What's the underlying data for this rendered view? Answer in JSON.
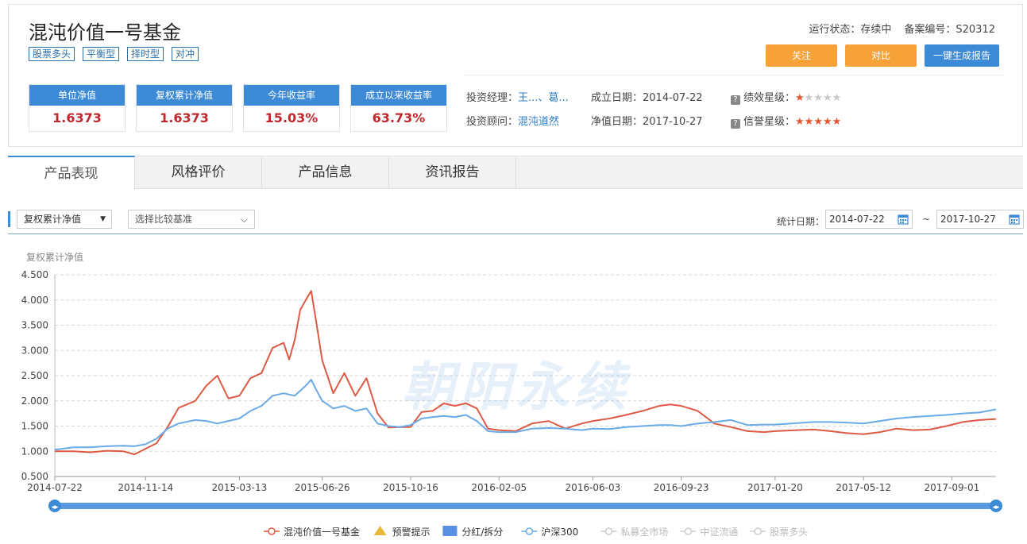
{
  "fund": {
    "title": "混沌价值一号基金",
    "tags": [
      "股票多头",
      "平衡型",
      "择时型",
      "对冲"
    ],
    "status_label": "运行状态：",
    "status_value": "存续中",
    "record_label": "备案编号：",
    "record_value": "S20312",
    "buttons": {
      "follow": "关注",
      "compare": "对比",
      "report": "一键生成报告"
    }
  },
  "stats": [
    {
      "label": "单位净值",
      "value": "1.6373"
    },
    {
      "label": "复权累计净值",
      "value": "1.6373"
    },
    {
      "label": "今年收益率",
      "value": "15.03%"
    },
    {
      "label": "成立以来收益率",
      "value": "63.73%"
    }
  ],
  "info": {
    "manager_label": "投资经理：",
    "manager_value": "王...、葛...",
    "advisor_label": "投资顾问：",
    "advisor_value": "混沌道然",
    "found_label": "成立日期：",
    "found_value": "2014-07-22",
    "nav_date_label": "净值日期：",
    "nav_date_value": "2017-10-27",
    "perf_label": "绩效星级：",
    "perf_stars": 1,
    "credit_label": "信誉星级：",
    "credit_stars": 5,
    "q_icon": "?"
  },
  "tabs": [
    "产品表现",
    "风格评价",
    "产品信息",
    "资讯报告"
  ],
  "toolbar": {
    "metric_select": "复权累计净值",
    "compare_select": "选择比较基准",
    "date_label": "统计日期：",
    "start_date": "2014-07-22",
    "end_date": "2017-10-27",
    "tilde": "~"
  },
  "colors": {
    "accent": "#3d8ad7",
    "fund_line": "#dd5a44",
    "index_line": "#6aaae6",
    "value_red": "#c0282d",
    "button_orange": "#f6a239"
  },
  "watermark": "朝阳永续",
  "chart_data": {
    "type": "line",
    "ylabel": "复权累计净值",
    "ylim": [
      0.5,
      4.5
    ],
    "yticks": [
      "4.500",
      "4.000",
      "3.500",
      "3.000",
      "2.500",
      "2.000",
      "1.500",
      "1.000",
      "0.500"
    ],
    "xticks": [
      "2014-07-22",
      "2014-11-14",
      "2015-03-13",
      "2015-06-26",
      "2015-10-16",
      "2016-02-05",
      "2016-06-03",
      "2016-09-23",
      "2017-01-20",
      "2017-05-12",
      "2017-09-01"
    ],
    "x_range": [
      "2014-07-22",
      "2017-10-27"
    ],
    "grid": true,
    "legend_position": "bottom",
    "series": [
      {
        "name": "混沌价值一号基金",
        "color": "#dd5a44",
        "points": [
          [
            "2014-07-22",
            1.0
          ],
          [
            "2014-08-15",
            1.0
          ],
          [
            "2014-09-05",
            0.98
          ],
          [
            "2014-09-26",
            1.01
          ],
          [
            "2014-10-17",
            1.0
          ],
          [
            "2014-10-31",
            0.94
          ],
          [
            "2014-11-14",
            1.05
          ],
          [
            "2014-11-28",
            1.16
          ],
          [
            "2014-12-12",
            1.48
          ],
          [
            "2014-12-26",
            1.86
          ],
          [
            "2015-01-16",
            2.0
          ],
          [
            "2015-01-30",
            2.3
          ],
          [
            "2015-02-13",
            2.5
          ],
          [
            "2015-02-27",
            2.05
          ],
          [
            "2015-03-13",
            2.1
          ],
          [
            "2015-03-27",
            2.45
          ],
          [
            "2015-04-10",
            2.55
          ],
          [
            "2015-04-24",
            3.05
          ],
          [
            "2015-05-08",
            3.15
          ],
          [
            "2015-05-15",
            2.82
          ],
          [
            "2015-05-22",
            3.2
          ],
          [
            "2015-05-29",
            3.8
          ],
          [
            "2015-06-05",
            4.0
          ],
          [
            "2015-06-12",
            4.18
          ],
          [
            "2015-06-19",
            3.5
          ],
          [
            "2015-06-26",
            2.8
          ],
          [
            "2015-07-10",
            2.15
          ],
          [
            "2015-07-24",
            2.55
          ],
          [
            "2015-08-07",
            2.1
          ],
          [
            "2015-08-21",
            2.45
          ],
          [
            "2015-09-04",
            1.75
          ],
          [
            "2015-09-18",
            1.47
          ],
          [
            "2015-10-02",
            1.48
          ],
          [
            "2015-10-16",
            1.48
          ],
          [
            "2015-10-30",
            1.78
          ],
          [
            "2015-11-13",
            1.8
          ],
          [
            "2015-11-27",
            1.95
          ],
          [
            "2015-12-11",
            1.9
          ],
          [
            "2015-12-25",
            1.95
          ],
          [
            "2016-01-08",
            1.85
          ],
          [
            "2016-01-22",
            1.45
          ],
          [
            "2016-02-05",
            1.42
          ],
          [
            "2016-02-26",
            1.4
          ],
          [
            "2016-03-18",
            1.55
          ],
          [
            "2016-04-08",
            1.6
          ],
          [
            "2016-04-29",
            1.45
          ],
          [
            "2016-05-20",
            1.55
          ],
          [
            "2016-06-03",
            1.6
          ],
          [
            "2016-06-24",
            1.65
          ],
          [
            "2016-07-15",
            1.72
          ],
          [
            "2016-08-05",
            1.8
          ],
          [
            "2016-08-26",
            1.9
          ],
          [
            "2016-09-09",
            1.93
          ],
          [
            "2016-09-23",
            1.9
          ],
          [
            "2016-10-14",
            1.8
          ],
          [
            "2016-11-04",
            1.55
          ],
          [
            "2016-11-25",
            1.48
          ],
          [
            "2016-12-16",
            1.4
          ],
          [
            "2017-01-06",
            1.38
          ],
          [
            "2017-01-20",
            1.4
          ],
          [
            "2017-02-17",
            1.42
          ],
          [
            "2017-03-10",
            1.43
          ],
          [
            "2017-03-31",
            1.4
          ],
          [
            "2017-04-21",
            1.36
          ],
          [
            "2017-05-12",
            1.34
          ],
          [
            "2017-06-02",
            1.38
          ],
          [
            "2017-06-23",
            1.45
          ],
          [
            "2017-07-14",
            1.42
          ],
          [
            "2017-08-04",
            1.43
          ],
          [
            "2017-08-25",
            1.5
          ],
          [
            "2017-09-15",
            1.58
          ],
          [
            "2017-10-06",
            1.62
          ],
          [
            "2017-10-27",
            1.64
          ]
        ]
      },
      {
        "name": "沪深300",
        "color": "#6aaae6",
        "points": [
          [
            "2014-07-22",
            1.03
          ],
          [
            "2014-08-15",
            1.08
          ],
          [
            "2014-09-05",
            1.08
          ],
          [
            "2014-09-26",
            1.1
          ],
          [
            "2014-10-17",
            1.11
          ],
          [
            "2014-10-31",
            1.1
          ],
          [
            "2014-11-14",
            1.14
          ],
          [
            "2014-11-28",
            1.25
          ],
          [
            "2014-12-12",
            1.45
          ],
          [
            "2014-12-26",
            1.55
          ],
          [
            "2015-01-16",
            1.62
          ],
          [
            "2015-01-30",
            1.6
          ],
          [
            "2015-02-13",
            1.55
          ],
          [
            "2015-02-27",
            1.6
          ],
          [
            "2015-03-13",
            1.65
          ],
          [
            "2015-03-27",
            1.8
          ],
          [
            "2015-04-10",
            1.9
          ],
          [
            "2015-04-24",
            2.1
          ],
          [
            "2015-05-08",
            2.15
          ],
          [
            "2015-05-22",
            2.1
          ],
          [
            "2015-06-05",
            2.3
          ],
          [
            "2015-06-12",
            2.42
          ],
          [
            "2015-06-19",
            2.2
          ],
          [
            "2015-06-26",
            2.0
          ],
          [
            "2015-07-10",
            1.85
          ],
          [
            "2015-07-24",
            1.9
          ],
          [
            "2015-08-07",
            1.8
          ],
          [
            "2015-08-21",
            1.85
          ],
          [
            "2015-09-04",
            1.55
          ],
          [
            "2015-09-18",
            1.5
          ],
          [
            "2015-10-02",
            1.48
          ],
          [
            "2015-10-16",
            1.52
          ],
          [
            "2015-10-30",
            1.65
          ],
          [
            "2015-11-13",
            1.68
          ],
          [
            "2015-11-27",
            1.7
          ],
          [
            "2015-12-11",
            1.68
          ],
          [
            "2015-12-25",
            1.72
          ],
          [
            "2016-01-08",
            1.6
          ],
          [
            "2016-01-22",
            1.4
          ],
          [
            "2016-02-05",
            1.38
          ],
          [
            "2016-02-26",
            1.38
          ],
          [
            "2016-03-18",
            1.45
          ],
          [
            "2016-04-08",
            1.46
          ],
          [
            "2016-04-29",
            1.45
          ],
          [
            "2016-05-20",
            1.42
          ],
          [
            "2016-06-03",
            1.45
          ],
          [
            "2016-06-24",
            1.44
          ],
          [
            "2016-07-15",
            1.48
          ],
          [
            "2016-08-05",
            1.5
          ],
          [
            "2016-08-26",
            1.52
          ],
          [
            "2016-09-09",
            1.52
          ],
          [
            "2016-09-23",
            1.5
          ],
          [
            "2016-10-14",
            1.55
          ],
          [
            "2016-11-04",
            1.58
          ],
          [
            "2016-11-25",
            1.62
          ],
          [
            "2016-12-16",
            1.52
          ],
          [
            "2017-01-06",
            1.53
          ],
          [
            "2017-01-20",
            1.53
          ],
          [
            "2017-02-17",
            1.56
          ],
          [
            "2017-03-10",
            1.58
          ],
          [
            "2017-03-31",
            1.58
          ],
          [
            "2017-04-21",
            1.57
          ],
          [
            "2017-05-12",
            1.55
          ],
          [
            "2017-06-02",
            1.6
          ],
          [
            "2017-06-23",
            1.65
          ],
          [
            "2017-07-14",
            1.68
          ],
          [
            "2017-08-04",
            1.7
          ],
          [
            "2017-08-25",
            1.72
          ],
          [
            "2017-09-15",
            1.75
          ],
          [
            "2017-10-06",
            1.77
          ],
          [
            "2017-10-27",
            1.83
          ]
        ]
      }
    ],
    "legend": [
      {
        "name": "混沌价值一号基金",
        "marker": "circle-line",
        "color": "#dd5a44",
        "active": true
      },
      {
        "name": "预警提示",
        "marker": "triangle",
        "color": "#e8b83a",
        "active": true
      },
      {
        "name": "分红/拆分",
        "marker": "square",
        "color": "#5a8fe6",
        "active": true
      },
      {
        "name": "沪深300",
        "marker": "circle-line",
        "color": "#6aaae6",
        "active": true
      },
      {
        "name": "私募全市场",
        "marker": "circle-line",
        "color": "#cccccc",
        "active": false
      },
      {
        "name": "中证流通",
        "marker": "circle-line",
        "color": "#cccccc",
        "active": false
      },
      {
        "name": "股票多头",
        "marker": "circle-line",
        "color": "#cccccc",
        "active": false
      }
    ]
  }
}
